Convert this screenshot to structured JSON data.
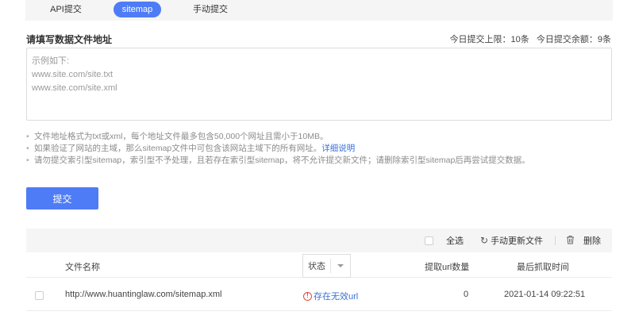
{
  "tabs": [
    {
      "label": "API提交",
      "active": false
    },
    {
      "label": "sitemap",
      "active": true
    },
    {
      "label": "手动提交",
      "active": false
    }
  ],
  "form": {
    "label": "请填写数据文件地址",
    "quota_limit": "今日提交上限：10条",
    "quota_remaining": "今日提交余额：9条",
    "placeholder": "示例如下:\nwww.site.com/site.txt\nwww.site.com/site.xml"
  },
  "tips": {
    "tip1": "文件地址格式为txt或xml，每个地址文件最多包含50,000个网址且需小于10MB。",
    "tip2_text": "如果验证了网站的主域，那么sitemap文件中可包含该网站主域下的所有网址。",
    "tip2_link": "详细说明",
    "tip3": "请勿提交索引型sitemap，索引型不予处理，且若存在索引型sitemap，将不允许提交新文件；请删除索引型sitemap后再尝试提交数据。"
  },
  "submit_label": "提交",
  "toolbar": {
    "select_all": "全选",
    "refresh": "手动更新文件",
    "delete": "删除"
  },
  "table": {
    "headers": {
      "name": "文件名称",
      "status": "状态",
      "count": "提取url数量",
      "time": "最后抓取时间"
    },
    "rows": [
      {
        "name": "http://www.huantinglaw.com/sitemap.xml",
        "status": "存在无效url",
        "count": "0",
        "time": "2021-01-14 09:22:51"
      }
    ]
  },
  "colors": {
    "primary": "#4e7cf6",
    "link": "#3b6fd8",
    "warning": "#e04a3b"
  }
}
